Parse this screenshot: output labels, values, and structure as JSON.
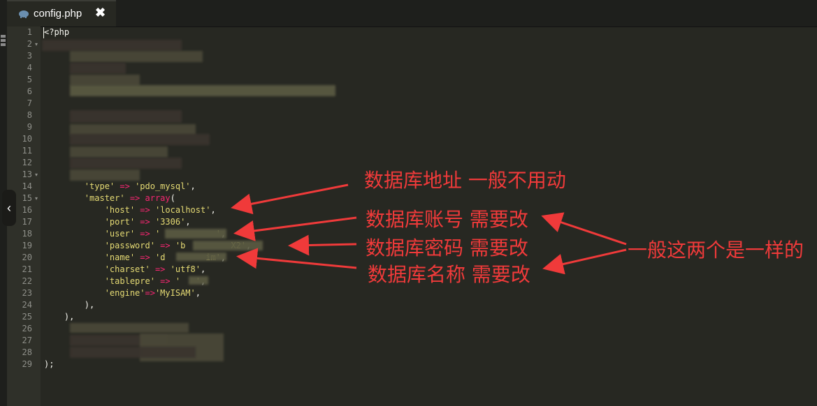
{
  "tab": {
    "filename": "config.php",
    "close_symbol": "✖"
  },
  "code": {
    "line_numbers": [
      "1",
      "2",
      "3",
      "4",
      "5",
      "6",
      "7",
      "8",
      "9",
      "10",
      "11",
      "12",
      "13",
      "14",
      "15",
      "16",
      "17",
      "18",
      "19",
      "20",
      "21",
      "22",
      "23",
      "24",
      "25",
      "26",
      "27",
      "28",
      "29"
    ],
    "lines": [
      [
        {
          "t": "<?php",
          "c": ""
        }
      ],
      [
        {
          "t": "",
          "c": ""
        }
      ],
      [
        {
          "t": "",
          "c": ""
        }
      ],
      [
        {
          "t": "",
          "c": ""
        }
      ],
      [
        {
          "t": "",
          "c": ""
        }
      ],
      [
        {
          "t": "",
          "c": ""
        }
      ],
      [
        {
          "t": "",
          "c": ""
        }
      ],
      [
        {
          "t": "",
          "c": ""
        }
      ],
      [
        {
          "t": "",
          "c": ""
        }
      ],
      [
        {
          "t": "",
          "c": ""
        }
      ],
      [
        {
          "t": "",
          "c": ""
        }
      ],
      [
        {
          "t": "",
          "c": ""
        }
      ],
      [
        {
          "t": "",
          "c": ""
        }
      ],
      [
        {
          "t": "        ",
          "c": ""
        },
        {
          "t": "'type'",
          "c": "s"
        },
        {
          "t": " => ",
          "c": "o"
        },
        {
          "t": "'pdo_mysql'",
          "c": "s"
        },
        {
          "t": ",",
          "c": ""
        }
      ],
      [
        {
          "t": "        ",
          "c": ""
        },
        {
          "t": "'master'",
          "c": "s"
        },
        {
          "t": " => ",
          "c": "o"
        },
        {
          "t": "array",
          "c": "o"
        },
        {
          "t": "(",
          "c": ""
        }
      ],
      [
        {
          "t": "            ",
          "c": ""
        },
        {
          "t": "'host'",
          "c": "s"
        },
        {
          "t": " => ",
          "c": "o"
        },
        {
          "t": "'localhost'",
          "c": "s"
        },
        {
          "t": ",",
          "c": ""
        }
      ],
      [
        {
          "t": "            ",
          "c": ""
        },
        {
          "t": "'port'",
          "c": "s"
        },
        {
          "t": " => ",
          "c": "o"
        },
        {
          "t": "'3306'",
          "c": "s"
        },
        {
          "t": ",",
          "c": ""
        }
      ],
      [
        {
          "t": "            ",
          "c": ""
        },
        {
          "t": "'user'",
          "c": "s"
        },
        {
          "t": " => ",
          "c": "o"
        },
        {
          "t": "'",
          "c": "s"
        },
        {
          "t": "           ",
          "c": ""
        },
        {
          "t": "'",
          "c": "s"
        },
        {
          "t": ",",
          "c": ""
        }
      ],
      [
        {
          "t": "            ",
          "c": ""
        },
        {
          "t": "'password'",
          "c": "s"
        },
        {
          "t": " => ",
          "c": "o"
        },
        {
          "t": "'b",
          "c": "s"
        },
        {
          "t": "         ",
          "c": ""
        },
        {
          "t": "X2'",
          "c": "s"
        },
        {
          "t": ",",
          "c": ""
        }
      ],
      [
        {
          "t": "            ",
          "c": ""
        },
        {
          "t": "'name'",
          "c": "s"
        },
        {
          "t": " => ",
          "c": "o"
        },
        {
          "t": "'d",
          "c": "s"
        },
        {
          "t": "        ",
          "c": ""
        },
        {
          "t": "im'",
          "c": "s"
        },
        {
          "t": ",",
          "c": ""
        }
      ],
      [
        {
          "t": "            ",
          "c": ""
        },
        {
          "t": "'charset'",
          "c": "s"
        },
        {
          "t": " => ",
          "c": "o"
        },
        {
          "t": "'utf8'",
          "c": "s"
        },
        {
          "t": ",",
          "c": ""
        }
      ],
      [
        {
          "t": "            ",
          "c": ""
        },
        {
          "t": "'tablepre'",
          "c": "s"
        },
        {
          "t": " => ",
          "c": "o"
        },
        {
          "t": "'",
          "c": "s"
        },
        {
          "t": "   ",
          "c": ""
        },
        {
          "t": "'",
          "c": "s"
        },
        {
          "t": ",",
          "c": ""
        }
      ],
      [
        {
          "t": "            ",
          "c": ""
        },
        {
          "t": "'engine'",
          "c": "s"
        },
        {
          "t": "=>",
          "c": "o"
        },
        {
          "t": "'MyISAM'",
          "c": "s"
        },
        {
          "t": ",",
          "c": ""
        }
      ],
      [
        {
          "t": "        ),",
          "c": ""
        }
      ],
      [
        {
          "t": "    ),",
          "c": ""
        }
      ],
      [
        {
          "t": "",
          "c": ""
        }
      ],
      [
        {
          "t": "",
          "c": ""
        }
      ],
      [
        {
          "t": "",
          "c": ""
        }
      ],
      [
        {
          "t": ");",
          "c": ""
        }
      ]
    ]
  },
  "annotations": {
    "db_address": "数据库地址  一般不用动",
    "db_account": "数据库账号 需要改",
    "db_password": "数据库密码 需要改",
    "db_name": "数据库名称 需要改",
    "usually_same": "一般这两个是一样的"
  },
  "colors": {
    "background": "#272822",
    "gutter": "#2f3029",
    "string": "#e6db74",
    "operator": "#f92672",
    "annotation": "#f03a3a"
  },
  "icons": {
    "tab_icon": "php-elephant-icon",
    "collapse": "chevron-left-icon"
  }
}
